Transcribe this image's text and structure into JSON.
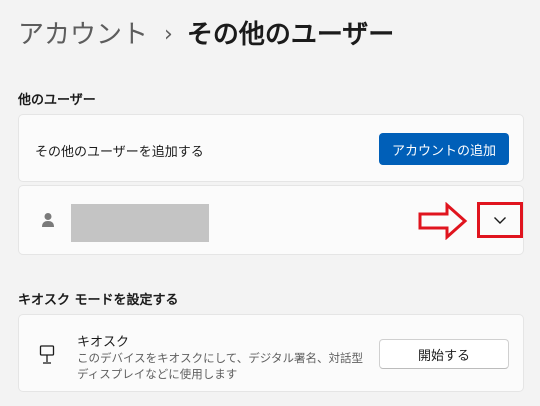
{
  "breadcrumb": {
    "parent": "アカウント",
    "separator": "›",
    "current": "その他のユーザー"
  },
  "other_users": {
    "section_title": "他のユーザー",
    "add_user_text": "その他のユーザーを追加する",
    "add_account_button": "アカウントの追加"
  },
  "user_entry": {
    "icon": "person-icon",
    "expand_icon": "chevron-down-icon"
  },
  "kiosk": {
    "section_title": "キオスク モードを設定する",
    "title": "キオスク",
    "description": "このデバイスをキオスクにして、デジタル署名、対話型ディスプレイなどに使用します",
    "start_button": "開始する",
    "icon": "kiosk-icon"
  },
  "colors": {
    "accent": "#005fb8",
    "annotation": "#e0141e",
    "background": "#f3f3f3",
    "card": "#fbfbfb"
  }
}
